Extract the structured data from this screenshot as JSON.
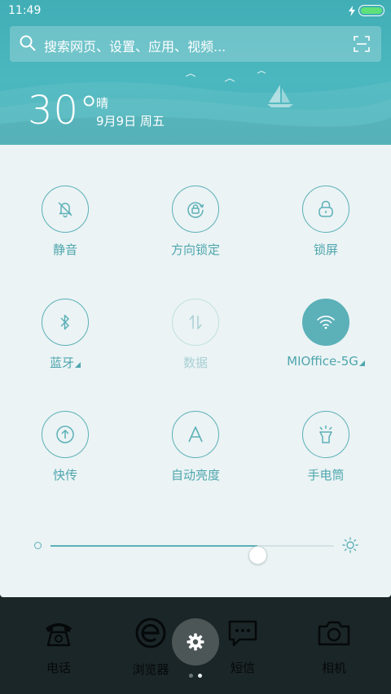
{
  "status_bar": {
    "time": "11:49"
  },
  "search": {
    "placeholder": "搜索网页、设置、应用、视频..."
  },
  "weather": {
    "temperature": "30°",
    "condition": "晴",
    "date": "9月9日 周五"
  },
  "quick_settings": [
    {
      "label": "静音",
      "icon": "bell-off-icon",
      "state": "off"
    },
    {
      "label": "方向锁定",
      "icon": "rotation-lock-icon",
      "state": "off"
    },
    {
      "label": "锁屏",
      "icon": "lock-icon",
      "state": "off"
    },
    {
      "label": "蓝牙",
      "icon": "bluetooth-icon",
      "state": "off",
      "expandable": true
    },
    {
      "label": "数据",
      "icon": "mobile-data-icon",
      "state": "disabled"
    },
    {
      "label": "MIOffice-5G",
      "icon": "wifi-icon",
      "state": "on",
      "expandable": true
    },
    {
      "label": "快传",
      "icon": "share-icon",
      "state": "off"
    },
    {
      "label": "自动亮度",
      "icon": "auto-brightness-icon",
      "state": "off"
    },
    {
      "label": "手电筒",
      "icon": "flashlight-icon",
      "state": "off"
    }
  ],
  "brightness": {
    "level": 0.73
  },
  "dock": {
    "items": [
      {
        "label": "电话",
        "icon": "phone-icon"
      },
      {
        "label": "浏览器",
        "icon": "browser-icon"
      },
      {
        "label": "短信",
        "icon": "message-icon"
      },
      {
        "label": "相机",
        "icon": "camera-icon"
      }
    ],
    "settings_icon": "gear-icon",
    "page_indicator": {
      "count": 2,
      "active": 1
    }
  },
  "colors": {
    "header": "#46b1ba",
    "accent": "#5cb0b8",
    "panel": "#ebf3f4",
    "dock_bg": "#1b2628"
  }
}
